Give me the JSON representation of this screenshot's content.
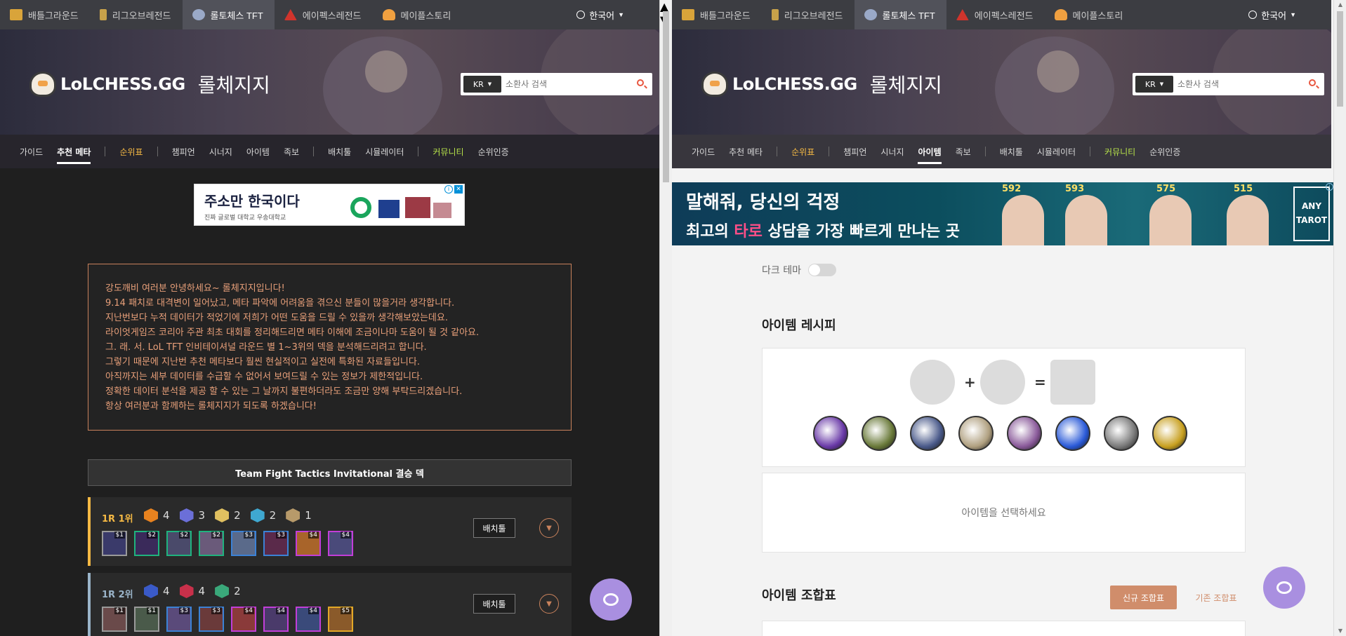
{
  "topbar": {
    "items": [
      "배틀그라운드",
      "리그오브레전드",
      "롤토체스 TFT",
      "에이펙스레전드",
      "메이플스토리"
    ],
    "active_index": 2,
    "language": "한국어"
  },
  "header": {
    "logo_text": "LoLCHESS.GG",
    "logo_sub": "롤체지지",
    "region": "KR",
    "search_placeholder": "소환사 검색"
  },
  "nav": {
    "items": [
      "가이드",
      "추천 메타",
      "순위표",
      "챔피언",
      "시너지",
      "아이템",
      "족보",
      "배치툴",
      "시뮬레이터",
      "커뮤니티",
      "순위인증"
    ]
  },
  "left": {
    "active_nav": "추천 메타",
    "ad": {
      "title": "주소만 한국이다",
      "sub": "진짜 글로벌 대학교 우송대학교",
      "close": "✕",
      "info": "i"
    },
    "notice_lines": [
      "강도깨비 여러분 안녕하세요~ 롤체지지입니다!",
      "9.14 패치로 대격변이 일어났고, 메타 파악에 어려움을 겪으신 분들이 많을거라 생각합니다.",
      "지난번보다 누적 데이터가 적었기에 저희가 어떤 도움을 드릴 수 있을까 생각해보았는데요.",
      "라이엇게임즈 코리아 주관 최초 대회를 정리해드리면 메타 이해에 조금이나마 도움이 될 것 같아요.",
      "그. 래. 서. LoL TFT 인비테이셔널 라운드 별 1~3위의 덱을 분석해드리려고 합니다.",
      "그렇기 때문에 지난번 추천 메타보다 훨씬 현실적이고 실전에 특화된 자료들입니다.",
      "아직까지는 세부 데이터를 수급할 수 없어서 보여드릴 수 있는 정보가 제한적입니다.",
      "정확한 데이터 분석을 제공 할 수 있는 그 날까지 불편하더라도 조금만 양해 부탁드리겠습니다.",
      "항상 여러분과 함께하는 롤체지지가 되도록 하겠습니다!"
    ],
    "deck_section_title": "Team Fight Tactics Invitational 결승 덱",
    "decks": [
      {
        "rank": "1R 1위",
        "rank_color": "#f5b944",
        "accent": "#f5b944",
        "traits": [
          {
            "count": "4",
            "color": "#e8821f"
          },
          {
            "count": "3",
            "color": "#6b6fd8"
          },
          {
            "count": "2",
            "color": "#e0c060"
          },
          {
            "count": "2",
            "color": "#3fa8d0"
          },
          {
            "count": "1",
            "color": "#b79a6a"
          }
        ],
        "champs": [
          {
            "cost": "$1",
            "border": "#9a9a9a",
            "bg": "#3a3a6a"
          },
          {
            "cost": "$2",
            "border": "#1fb37e",
            "bg": "#3a2a5a"
          },
          {
            "cost": "$2",
            "border": "#1fb37e",
            "bg": "#4a4a6a"
          },
          {
            "cost": "$2",
            "border": "#1fb37e",
            "bg": "#6a5a7a"
          },
          {
            "cost": "$3",
            "border": "#3b82d6",
            "bg": "#5a6a8a"
          },
          {
            "cost": "$3",
            "border": "#3b82d6",
            "bg": "#5a2a4a"
          },
          {
            "cost": "$4",
            "border": "#c23ed8",
            "bg": "#a8642a"
          },
          {
            "cost": "$4",
            "border": "#c23ed8",
            "bg": "#4a4a7a"
          }
        ],
        "button": "배치툴"
      },
      {
        "rank": "1R 2위",
        "rank_color": "#9ab4c9",
        "accent": "#9ab4c9",
        "traits": [
          {
            "count": "4",
            "color": "#3a5ac8"
          },
          {
            "count": "4",
            "color": "#c8304a"
          },
          {
            "count": "2",
            "color": "#3aa87a"
          }
        ],
        "champs": [
          {
            "cost": "$1",
            "border": "#9a9a9a",
            "bg": "#6a4a4a"
          },
          {
            "cost": "$1",
            "border": "#9a9a9a",
            "bg": "#4a5a4a"
          },
          {
            "cost": "$3",
            "border": "#3b82d6",
            "bg": "#5a4a7a"
          },
          {
            "cost": "$3",
            "border": "#3b82d6",
            "bg": "#6a3a3a"
          },
          {
            "cost": "$4",
            "border": "#c23ed8",
            "bg": "#8a3a3a"
          },
          {
            "cost": "$4",
            "border": "#c23ed8",
            "bg": "#4a3a6a"
          },
          {
            "cost": "$4",
            "border": "#c23ed8",
            "bg": "#3a4a7a"
          },
          {
            "cost": "$5",
            "border": "#e3a826",
            "bg": "#8a5a2a"
          }
        ],
        "button": "배치툴"
      }
    ]
  },
  "right": {
    "active_nav": "아이템",
    "ad": {
      "line1": "말해줘, 당신의 걱정",
      "line2_pre": "최고의 ",
      "line2_pink": "타로",
      "line2_post": " 상담을 가장 빠르게 만나는 곳",
      "numbers": [
        "592",
        "593",
        "575",
        "515"
      ],
      "brand": "ANY TAROT",
      "info": "i"
    },
    "dark_theme_label": "다크 테마",
    "recipe_title": "아이템 레시피",
    "recipe_plus": "+",
    "recipe_equals": "=",
    "items": [
      {
        "name": "sword-item-icon",
        "color": "#6a3aa8"
      },
      {
        "name": "bow-item-icon",
        "color": "#6a7a3a"
      },
      {
        "name": "chain-vest-item-icon",
        "color": "#4a5a8a"
      },
      {
        "name": "cloak-item-icon",
        "color": "#b0a080"
      },
      {
        "name": "rod-item-icon",
        "color": "#8a5a9a"
      },
      {
        "name": "tear-item-icon",
        "color": "#2a5ad8"
      },
      {
        "name": "belt-item-icon",
        "color": "#7a7a7a"
      },
      {
        "name": "spatula-item-icon",
        "color": "#c8a020"
      }
    ],
    "select_prompt": "아이템을 선택하세요",
    "combo_title": "아이템 조합표",
    "btn_new": "신규 조합표",
    "btn_old": "기존 조합표"
  }
}
